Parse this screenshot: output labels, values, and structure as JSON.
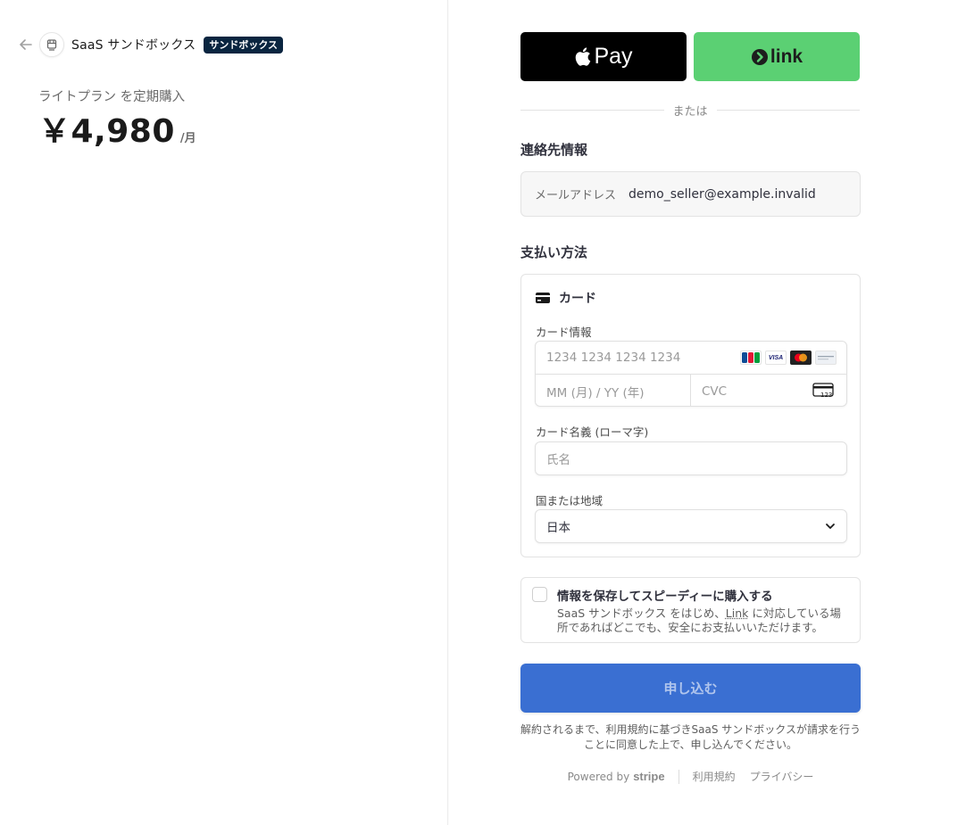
{
  "merchant": {
    "name": "SaaS サンドボックス",
    "badge": "サンドボックス"
  },
  "summary": {
    "plan_label": "ライトプラン を定期購入",
    "price": "￥4,980",
    "price_unit": "/月"
  },
  "wallets": {
    "apple_pay_label": "Pay",
    "link_label": "link"
  },
  "divider_text": "または",
  "contact": {
    "section_title": "連絡先情報",
    "email_label": "メールアドレス",
    "email_value": "demo_seller@example.invalid"
  },
  "payment": {
    "section_title": "支払い方法",
    "method_label": "カード",
    "card_info_label": "カード情報",
    "card_number_placeholder": "1234 1234 1234 1234",
    "expiry_placeholder": "MM (月) / YY (年)",
    "cvc_placeholder": "CVC",
    "cardholder_label": "カード名義 (ローマ字)",
    "cardholder_placeholder": "氏名",
    "country_label": "国または地域",
    "country_value": "日本",
    "brands": [
      {
        "name": "JCB",
        "color": "#0e4c96"
      },
      {
        "name": "VISA",
        "color": "#1a1f71"
      },
      {
        "name": "mastercard",
        "color": "#eb001b"
      },
      {
        "name": "DISCOVER",
        "color": "#9aa5b1"
      }
    ],
    "cvc_icon_text": "123"
  },
  "save_info": {
    "title": "情報を保存してスピーディーに購入する",
    "desc_pre": "SaaS サンドボックス をはじめ、",
    "desc_link": "Link",
    "desc_post": " に対応している場所であればどこでも、安全にお支払いいただけます。"
  },
  "submit": {
    "label": "申し込む",
    "color": "#3a6fd2"
  },
  "terms_text": "解約されるまで、利用規約に基づきSaaS サンドボックスが請求を行うことに同意した上で、申し込んでください。",
  "footer": {
    "powered_by": "Powered by",
    "stripe": "stripe",
    "terms": "利用規約",
    "privacy": "プライバシー"
  },
  "colors": {
    "apple_pay_bg": "#000000",
    "link_bg": "#5bd073",
    "badge_bg": "#0a2540"
  }
}
